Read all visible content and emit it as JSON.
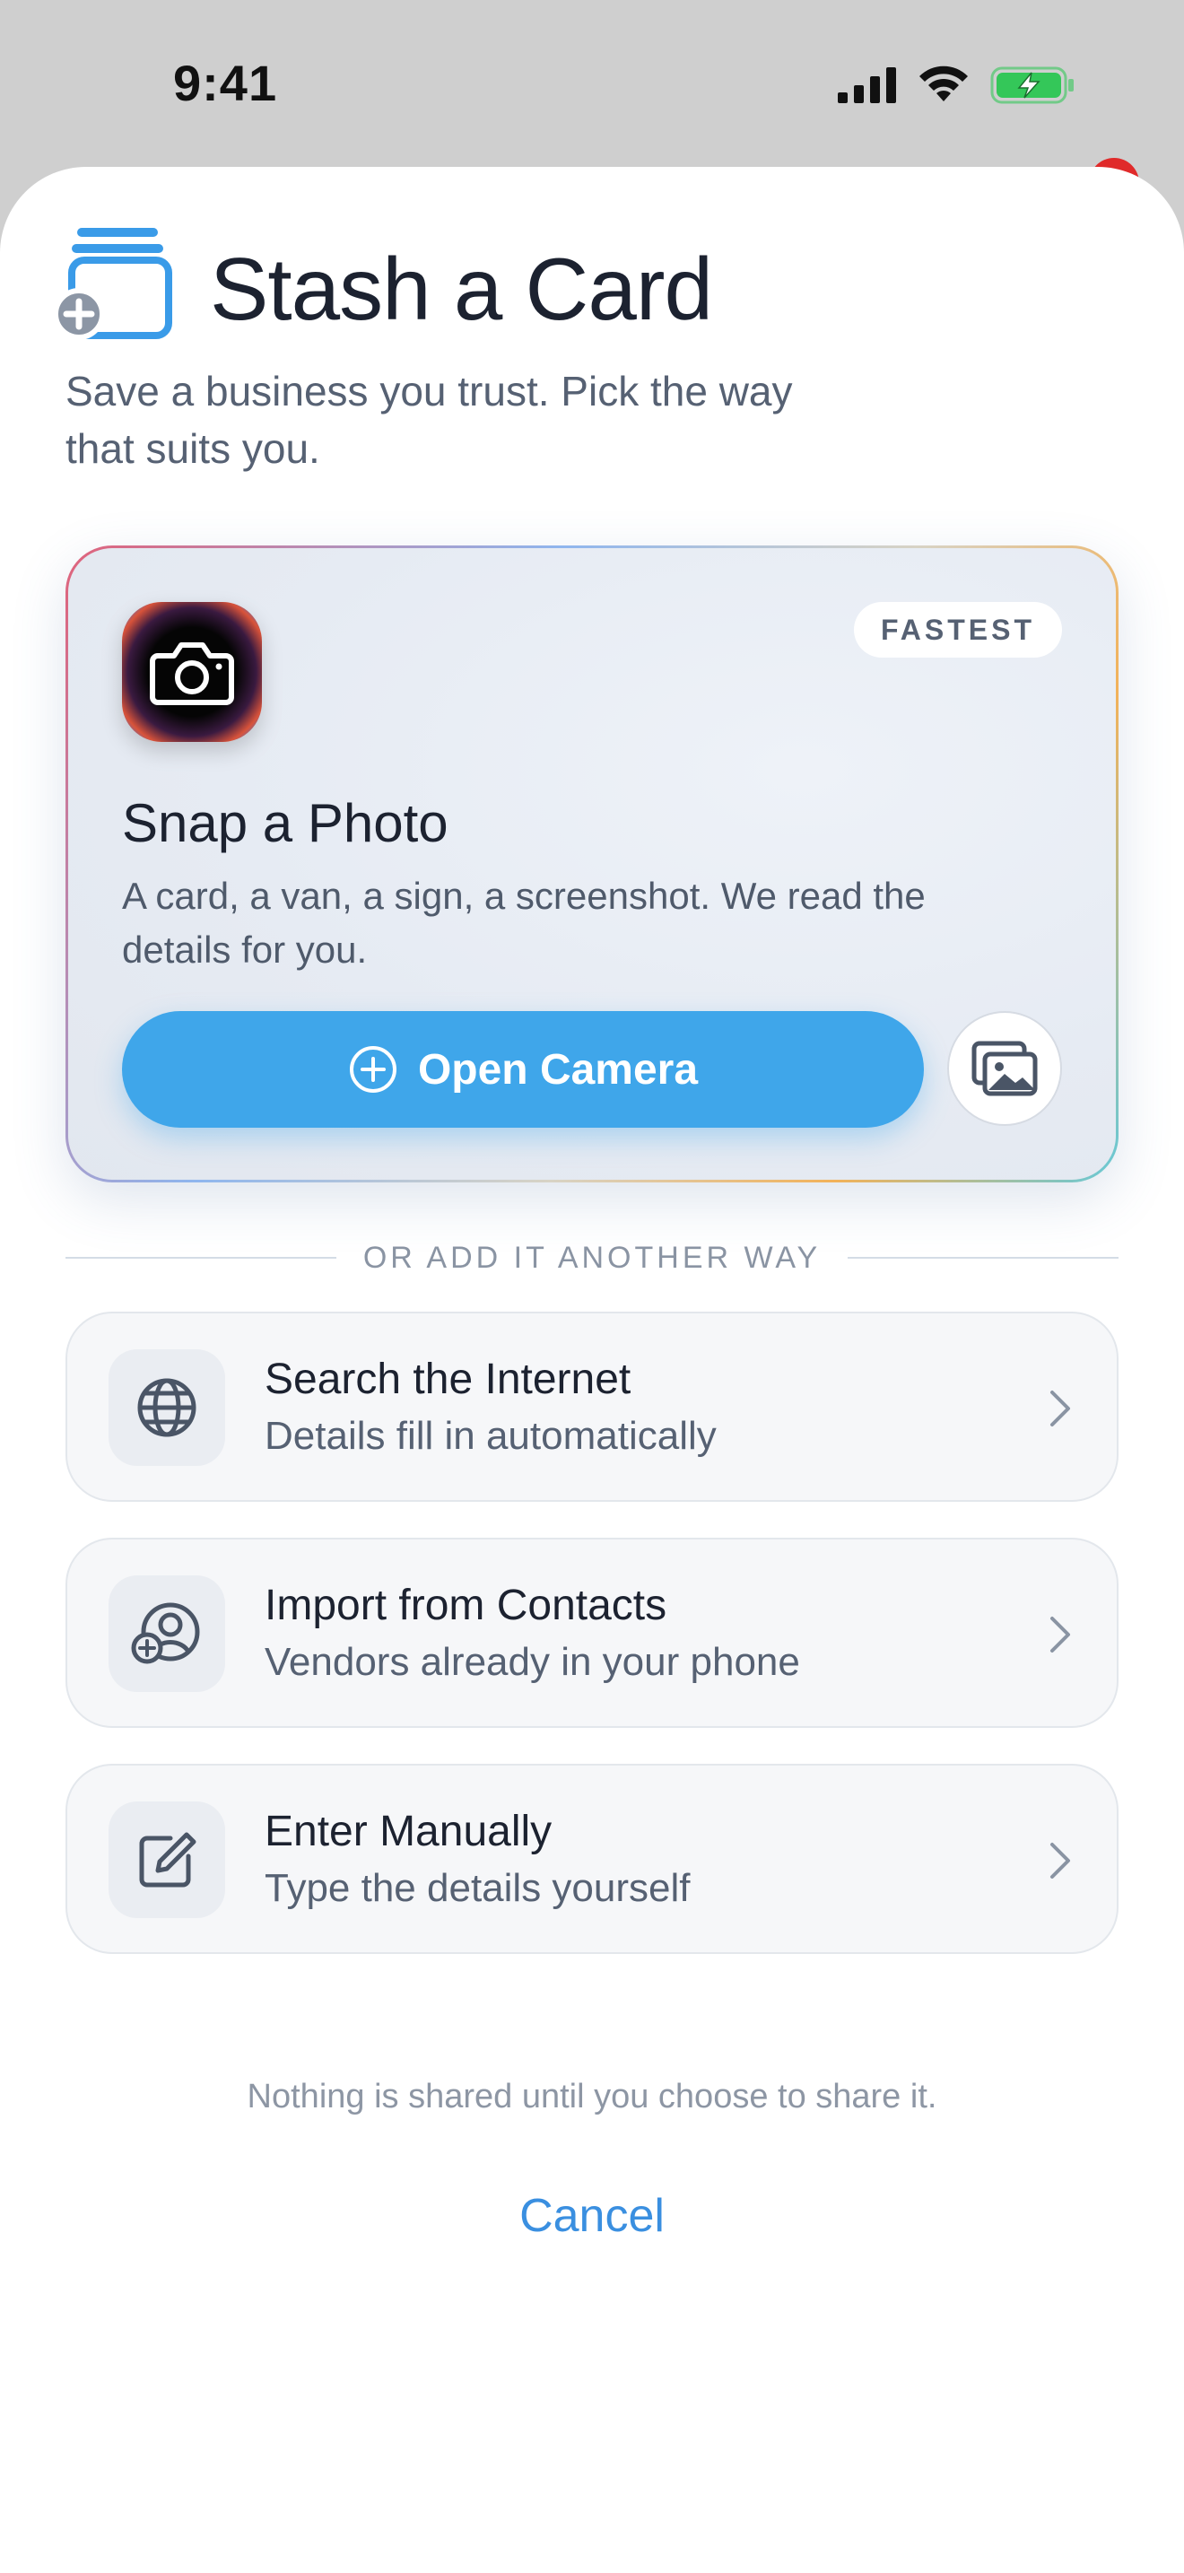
{
  "status_bar": {
    "time": "9:41"
  },
  "sheet": {
    "title": "Stash a Card",
    "subtitle": "Save a business you trust. Pick the way that suits you."
  },
  "hero": {
    "badge": "FASTEST",
    "title": "Snap a Photo",
    "description": "A card, a van, a sign, a screenshot. We read the details for you.",
    "primary_button": "Open Camera"
  },
  "divider": {
    "label": "OR ADD IT ANOTHER WAY"
  },
  "options": [
    {
      "title": "Search the Internet",
      "subtitle": "Details fill in automatically",
      "icon": "globe-icon"
    },
    {
      "title": "Import from Contacts",
      "subtitle": "Vendors already in your phone",
      "icon": "add-contact-icon"
    },
    {
      "title": "Enter Manually",
      "subtitle": "Type the details yourself",
      "icon": "edit-icon"
    }
  ],
  "footer": {
    "privacy_note": "Nothing is shared until you choose to share it.",
    "cancel_label": "Cancel"
  },
  "colors": {
    "accent": "#3fa6ea",
    "cancel": "#3a8fe0",
    "title_icon": "#3a9be8",
    "battery": "#34c759",
    "notification": "#e02a2a"
  }
}
